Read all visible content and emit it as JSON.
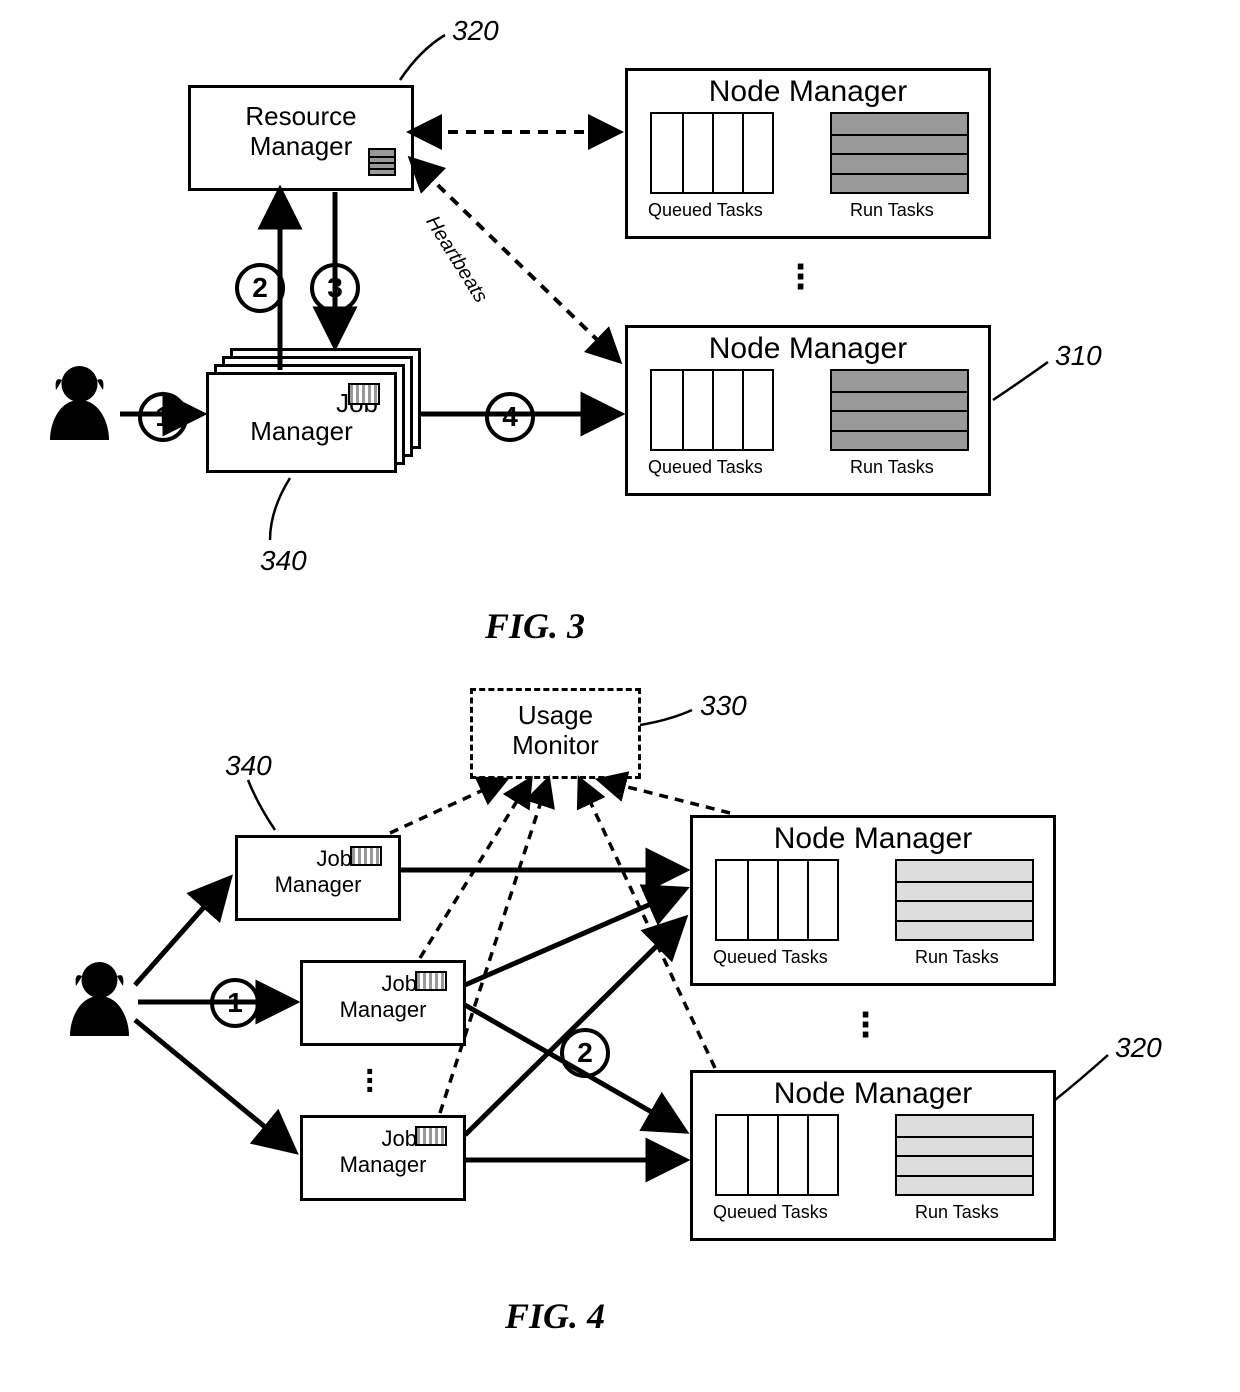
{
  "fig3": {
    "caption": "FIG. 3",
    "refs": {
      "r320": "320",
      "r310": "310",
      "r340": "340"
    },
    "resourceManager": {
      "label1": "Resource",
      "label2": "Manager"
    },
    "jobManager": {
      "label1": "Job",
      "label2": "Manager"
    },
    "nodeManagerTop": {
      "title": "Node Manager",
      "queued": "Queued Tasks",
      "run": "Run Tasks"
    },
    "nodeManagerBottom": {
      "title": "Node Manager",
      "queued": "Queued Tasks",
      "run": "Run Tasks"
    },
    "heartbeats": "Heartbeats",
    "steps": {
      "s1": "1",
      "s2": "2",
      "s3": "3",
      "s4": "4"
    }
  },
  "fig4": {
    "caption": "FIG. 4",
    "refs": {
      "r330": "330",
      "r340": "340",
      "r320": "320"
    },
    "usageMonitor": {
      "label1": "Usage",
      "label2": "Monitor"
    },
    "jobManager": {
      "label1": "Job",
      "label2": "Manager"
    },
    "nodeManagerTop": {
      "title": "Node Manager",
      "queued": "Queued Tasks",
      "run": "Run Tasks"
    },
    "nodeManagerBottom": {
      "title": "Node Manager",
      "queued": "Queued Tasks",
      "run": "Run Tasks"
    },
    "steps": {
      "s1": "1",
      "s2": "2"
    }
  }
}
